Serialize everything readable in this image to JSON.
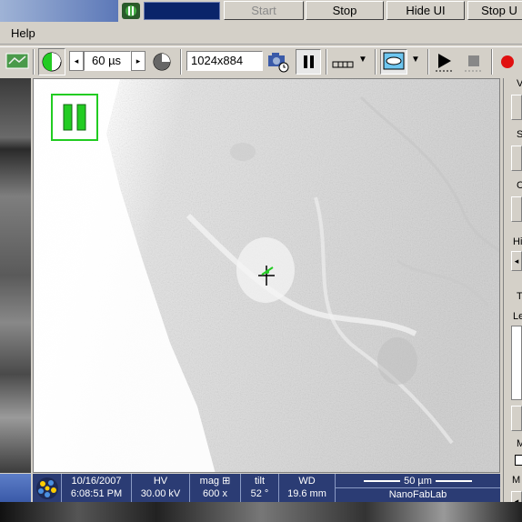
{
  "colors": {
    "accent_blue": "#2b3c74",
    "title_blue": "#5c78b8",
    "green": "#22cc22",
    "record_red": "#e01010"
  },
  "top_buttons": {
    "start": "Start",
    "stop": "Stop",
    "hide_ui": "Hide UI",
    "stop_right": "Stop U"
  },
  "menu": {
    "help": "Help"
  },
  "toolbar": {
    "dwell_time": "60 µs",
    "resolution": "1024x884",
    "icons": [
      "snapshot-icon",
      "clock-icon",
      "arrow-left-icon",
      "arrow-right-icon",
      "timer-icon",
      "camera-icon",
      "pause-icon",
      "line-scan-icon",
      "dropdown-arrow-icon",
      "lens-icon",
      "dropdown-arrow-icon",
      "play-icon",
      "stop-icon",
      "record-icon"
    ]
  },
  "databar": {
    "date": "10/16/2007",
    "time": "6:08:51 PM",
    "hv_label": "HV",
    "hv_value": "30.00 kV",
    "mag_label": "mag",
    "mag_value": "600 x",
    "tilt_label": "tilt",
    "tilt_value": "52 °",
    "wd_label": "WD",
    "wd_value": "19.6 mm",
    "scale_label": "50 µm",
    "lab": "NanoFabLab"
  },
  "right_panel": {
    "labels": [
      "V",
      "S",
      "C",
      "Hi",
      "T",
      "Le",
      "M",
      "M"
    ]
  }
}
